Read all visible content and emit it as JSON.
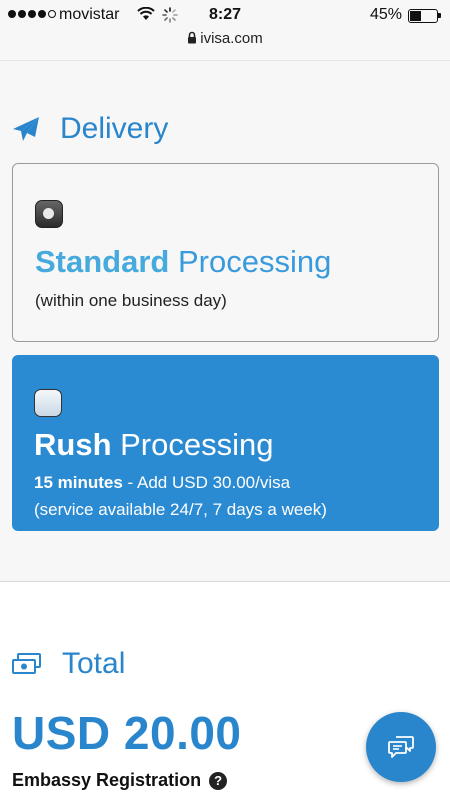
{
  "status_bar": {
    "carrier": "movistar",
    "time": "8:27",
    "battery_percent": "45%",
    "battery_level": 0.45,
    "signal_bars": 4
  },
  "browser": {
    "url": "ivisa.com"
  },
  "delivery": {
    "heading": "Delivery",
    "options": [
      {
        "title_bold": "Standard",
        "title_rest": " Processing",
        "subtitle": "(within one business day)",
        "selected": true
      },
      {
        "title_bold": "Rush",
        "title_rest": " Processing",
        "time_bold": "15 minutes",
        "price_text": " - Add USD 30.00/visa",
        "availability": "(service available 24/7, 7 days a week)",
        "selected": false
      }
    ]
  },
  "total": {
    "heading": "Total",
    "amount": "USD 20.00",
    "line_item": "Embassy Registration"
  },
  "icons": {
    "delivery": "paper-plane-icon",
    "total": "money-stack-icon",
    "help": "question-circle-icon",
    "chat": "chat-bubbles-icon"
  },
  "colors": {
    "brand_blue": "#2a86cc",
    "rush_card": "#2a8bd3",
    "standard_title": "#46aadd"
  }
}
